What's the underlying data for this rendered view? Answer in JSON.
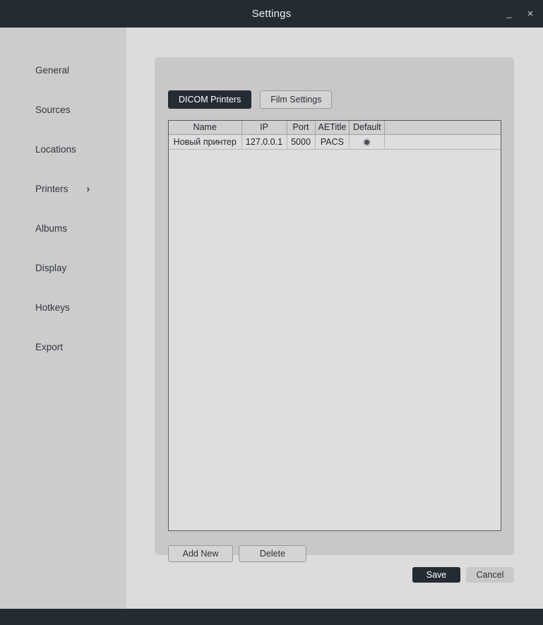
{
  "window": {
    "title": "Settings",
    "minimize_icon": "minimize-icon",
    "minimize_glyph": "_",
    "close_icon": "close-icon",
    "close_glyph": "×"
  },
  "sidebar": {
    "items": [
      {
        "label": "General",
        "chevron": ""
      },
      {
        "label": "Sources",
        "chevron": ""
      },
      {
        "label": "Locations",
        "chevron": ""
      },
      {
        "label": "Printers",
        "chevron": "›"
      },
      {
        "label": "Albums",
        "chevron": ""
      },
      {
        "label": "Display",
        "chevron": ""
      },
      {
        "label": "Hotkeys",
        "chevron": ""
      },
      {
        "label": "Export",
        "chevron": ""
      }
    ],
    "selected": "Printers"
  },
  "tabs": [
    {
      "label": "DICOM Printers",
      "active": true
    },
    {
      "label": "Film Settings",
      "active": false
    }
  ],
  "table": {
    "columns": [
      "Name",
      "IP",
      "Port",
      "AETitle",
      "Default"
    ],
    "rows": [
      {
        "name": "Новый принтер",
        "ip": "127.0.0.1",
        "port": "5000",
        "aetitle": "PACS",
        "default_selected": true
      }
    ]
  },
  "card_actions": {
    "add_new_label": "Add New",
    "delete_label": "Delete"
  },
  "footer_actions": {
    "save_label": "Save",
    "cancel_label": "Cancel"
  },
  "colors": {
    "titlebar": "#252b33",
    "sidebar": "#cccccc",
    "content": "#dcdcdc",
    "card": "#c8c8c8",
    "accent_dark": "#252b33",
    "table_header": "#d0d0d0",
    "table_body": "#dedede"
  }
}
